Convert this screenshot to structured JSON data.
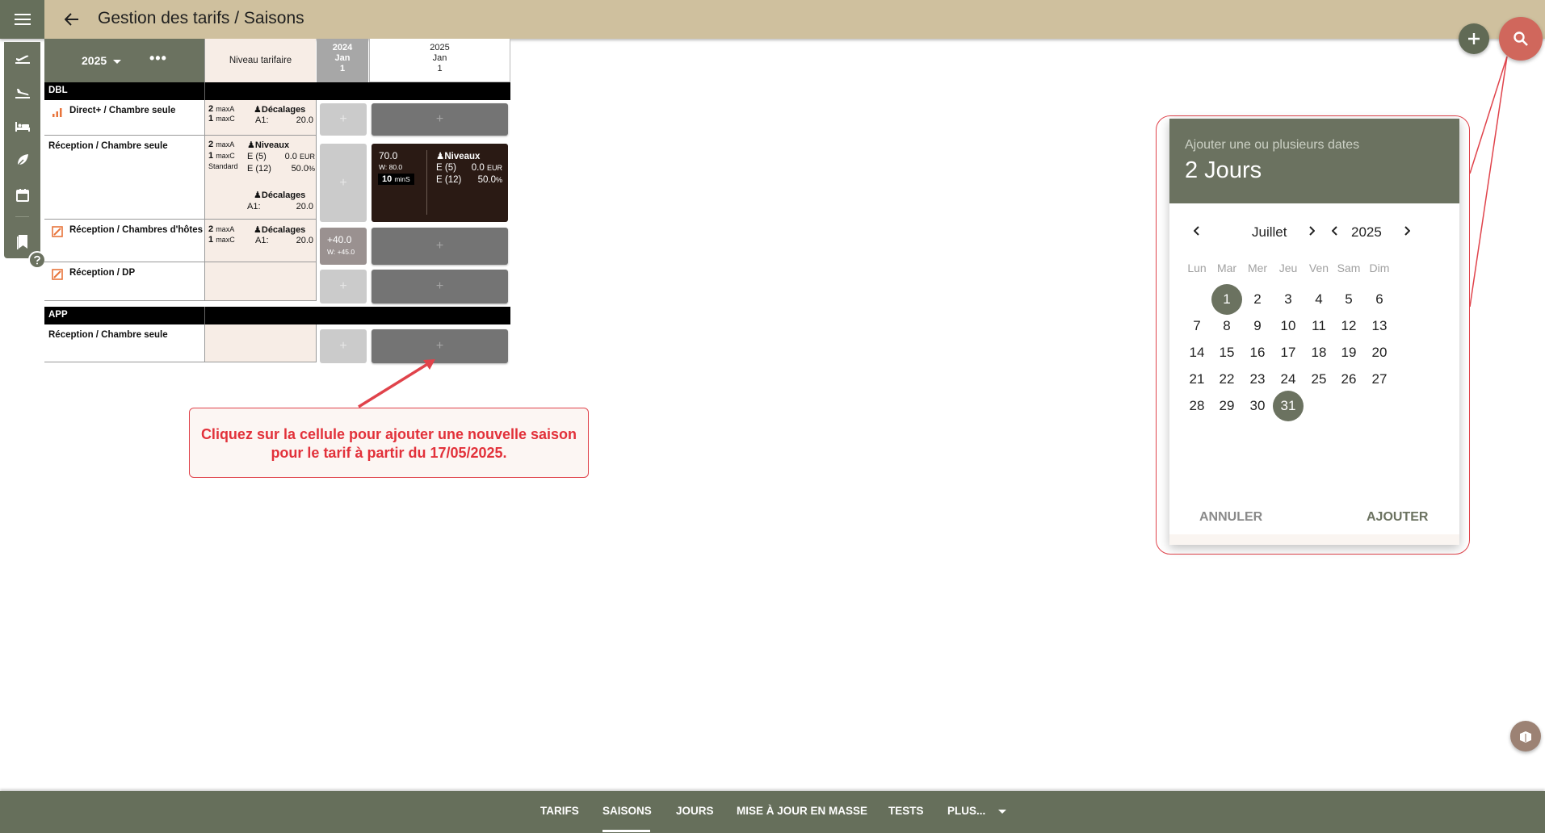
{
  "header": {
    "title": "Gestion des tarifs / Saisons"
  },
  "grid": {
    "year": "2025",
    "niveau_header": "Niveau tarifaire",
    "col_2024": {
      "year": "2024",
      "month": "Jan",
      "day": "1"
    },
    "col_2025": {
      "year": "2025",
      "month": "Jan",
      "day": "1"
    },
    "add_symbol": "+",
    "sections": [
      {
        "label": "DBL"
      },
      {
        "label": "APP"
      }
    ],
    "rows": [
      {
        "label": "Direct+ / Chambre seule",
        "maxA": "2",
        "maxC": "1",
        "decalages": "Décalages",
        "a1": "A1:",
        "a1_val": "20.0"
      },
      {
        "label": "Réception / Chambre seule",
        "maxA": "2",
        "maxC": "1",
        "standard": "Standard",
        "niveaux": "Niveaux",
        "e5": "E (5)",
        "e5_val": "0.0",
        "eur": "EUR",
        "e12": "E (12)",
        "e12_val": "50.0",
        "pct": "%",
        "decalages": "Décalages",
        "a1": "A1:",
        "a1_val": "20.0",
        "season": {
          "price": "70.0",
          "w": "W: 80.0",
          "mins_n": "10",
          "mins": "minS",
          "niveaux": "Niveaux",
          "e5": "E (5)",
          "e5_val": "0.0",
          "eur": "EUR",
          "e12": "E (12)",
          "e12_val": "50.0",
          "pct": "%"
        }
      },
      {
        "label": "Réception / Chambres d'hôtes",
        "maxA": "2",
        "maxC": "1",
        "decalages": "Décalages",
        "a1": "A1:",
        "a1_val": "20.0",
        "cell2024": {
          "price": "+40.0",
          "w": "W: +45.0"
        }
      },
      {
        "label": "Réception / DP"
      },
      {
        "label": "Réception / Chambre seule"
      }
    ],
    "max_a_label": "maxA",
    "max_c_label": "maxC"
  },
  "annotation": {
    "text": "Cliquez sur la cellule pour ajouter une nouvelle saison pour le tarif à partir du 17/05/2025."
  },
  "datepicker": {
    "subtitle": "Ajouter une ou plusieurs dates",
    "title": "2 Jours",
    "month": "Juillet",
    "year": "2025",
    "weekdays": [
      "Lun",
      "Mar",
      "Mer",
      "Jeu",
      "Ven",
      "Sam",
      "Dim"
    ],
    "selected_days": [
      1,
      31
    ],
    "cancel_label": "ANNULER",
    "ok_label": "AJOUTER"
  },
  "bottom_tabs": [
    {
      "label": "TARIFS"
    },
    {
      "label": "SAISONS"
    },
    {
      "label": "JOURS"
    },
    {
      "label": "MISE À JOUR EN MASSE"
    },
    {
      "label": "TESTS"
    },
    {
      "label": "PLUS..."
    }
  ],
  "colors": {
    "olive": "#6b7260",
    "topbar": "#cfc09e",
    "annotation_red": "#e0434b",
    "season_dark": "#2a1a14"
  }
}
